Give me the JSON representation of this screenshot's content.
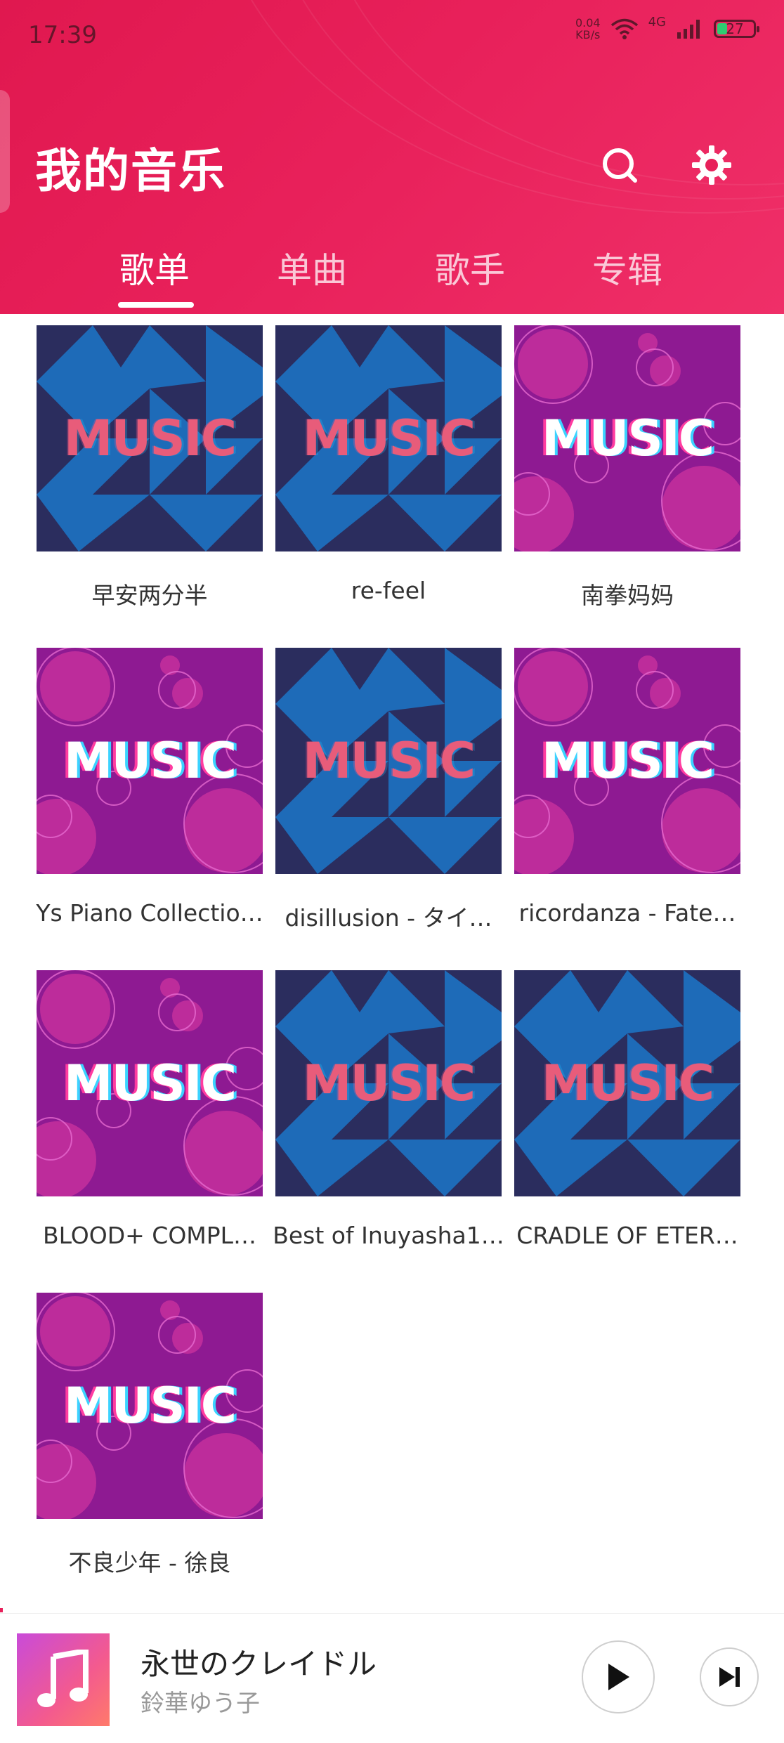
{
  "status": {
    "time": "17:39",
    "netspeed_value": "0.04",
    "netspeed_unit": "KB/s",
    "network": "4G",
    "battery": "27"
  },
  "header": {
    "title": "我的音乐"
  },
  "tabs": [
    {
      "label": "歌单",
      "active": true
    },
    {
      "label": "单曲",
      "active": false
    },
    {
      "label": "歌手",
      "active": false
    },
    {
      "label": "专辑",
      "active": false
    }
  ],
  "cover_text": "MUSIC",
  "playlists": [
    {
      "label": "早安两分半",
      "cover": "blue"
    },
    {
      "label": "re-feel",
      "cover": "blue"
    },
    {
      "label": "南拳妈妈",
      "cover": "purple"
    },
    {
      "label": "Ys Piano Collectio…",
      "cover": "purple"
    },
    {
      "label": "disillusion - タイ…",
      "cover": "blue"
    },
    {
      "label": "ricordanza - Fate…",
      "cover": "purple"
    },
    {
      "label": "BLOOD+ COMPL…",
      "cover": "purple"
    },
    {
      "label": "Best of Inuyasha1…",
      "cover": "blue"
    },
    {
      "label": "CRADLE OF ETER…",
      "cover": "blue"
    },
    {
      "label": "不良少年 - 徐良",
      "cover": "purple"
    }
  ],
  "player": {
    "song": "永世のクレイドル",
    "artist": "鈴華ゆう子"
  },
  "colors": {
    "accent": "#e8205a",
    "cover_blue": "#1e6bb8",
    "cover_navy": "#2b2d5e",
    "cover_purple": "#8e1a92",
    "cover_pink": "#d2349f"
  },
  "icons": {
    "search": "search-icon",
    "settings": "gear-icon",
    "play": "play-icon",
    "next": "skip-next-icon",
    "note": "music-note-icon"
  }
}
